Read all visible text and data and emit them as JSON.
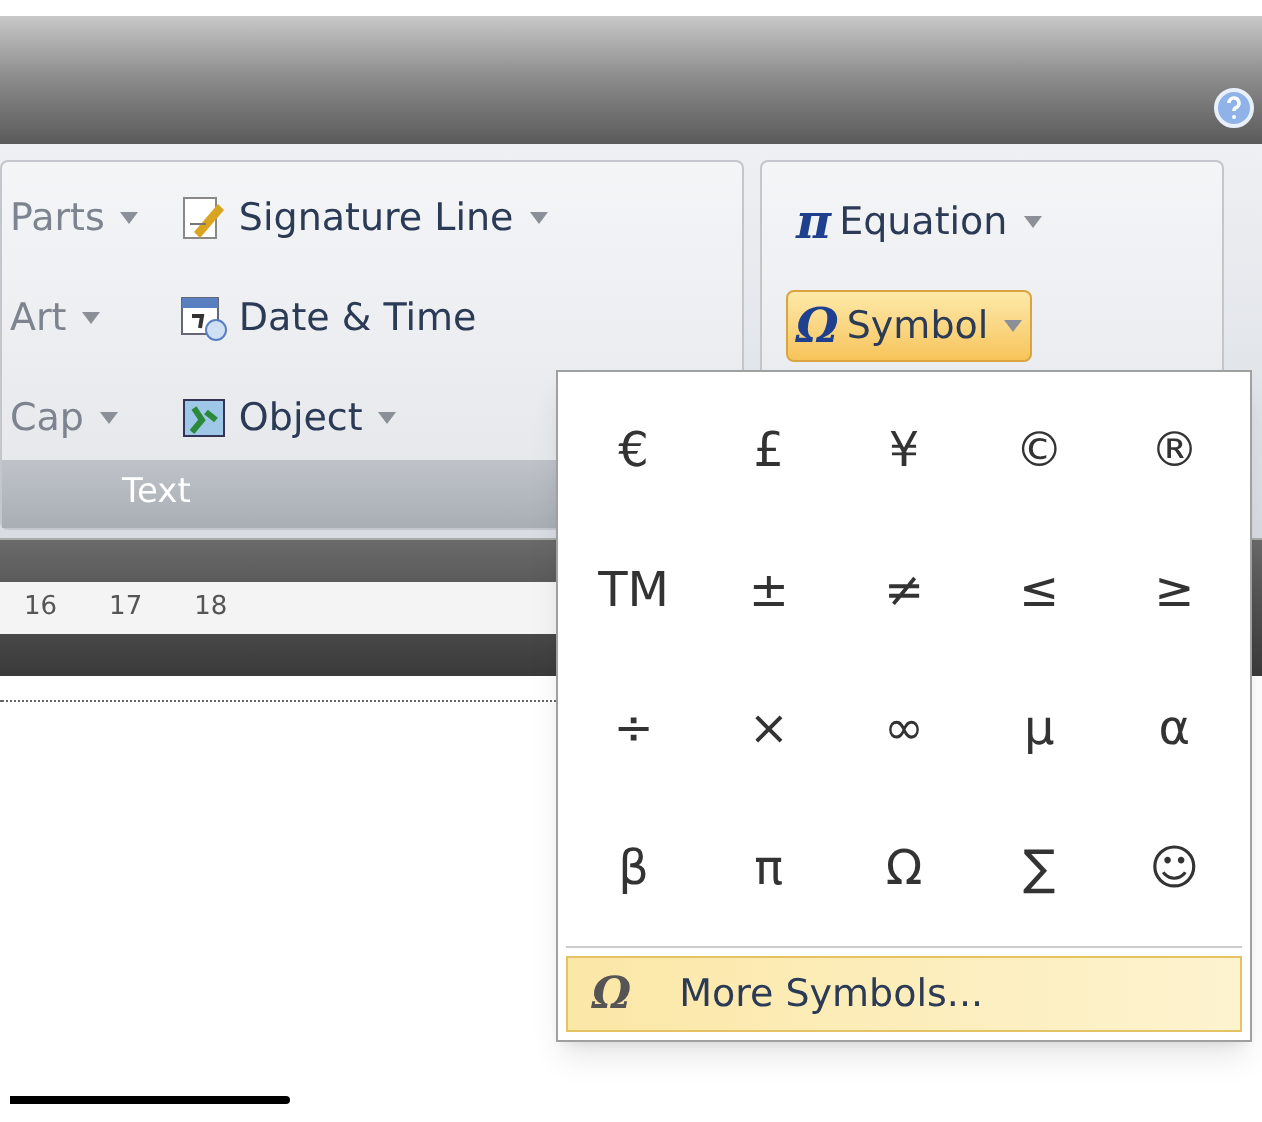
{
  "ribbon": {
    "text_group": {
      "label": "Text",
      "columns": [
        [
          {
            "label": "Parts",
            "menu": true
          },
          {
            "label": "Art",
            "menu": true
          },
          {
            "label": "Cap",
            "menu": true
          }
        ],
        [
          {
            "label": "Signature Line",
            "menu": true,
            "kind": "signature"
          },
          {
            "label": "Date & Time",
            "menu": false,
            "kind": "datetime"
          },
          {
            "label": "Object",
            "menu": true,
            "kind": "object"
          }
        ]
      ]
    },
    "symbols_group": {
      "buttons": [
        {
          "icon": "π",
          "label": "Equation",
          "menu": true,
          "selected": false
        },
        {
          "icon": "Ω",
          "label": "Symbol",
          "menu": true,
          "selected": true
        }
      ]
    }
  },
  "ruler": {
    "ticks": [
      "16",
      "17",
      "18"
    ]
  },
  "symbol_menu": {
    "symbols": [
      "€",
      "£",
      "¥",
      "©",
      "®",
      "TM",
      "±",
      "≠",
      "≤",
      "≥",
      "÷",
      "×",
      "∞",
      "µ",
      "α",
      "β",
      "π",
      "Ω",
      "∑",
      "☺"
    ],
    "more": {
      "icon": "Ω",
      "label": "More Symbols...",
      "highlighted": true
    }
  }
}
